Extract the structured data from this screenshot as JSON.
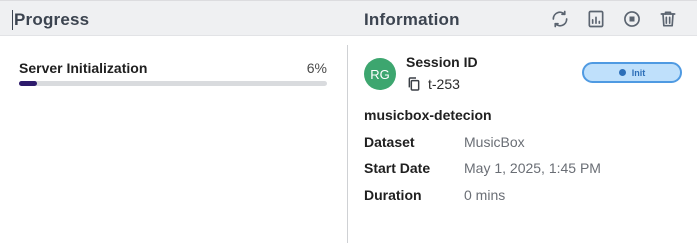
{
  "header": {
    "progress_title": "Progress",
    "info_title": "Information",
    "icons": [
      "refresh-icon",
      "report-icon",
      "stop-icon",
      "delete-icon"
    ]
  },
  "progress": {
    "label": "Server Initialization",
    "value_text": "6%",
    "value": 0.06,
    "bar_color": "#2d1a6b"
  },
  "info": {
    "avatar_initials": "RG",
    "avatar_color": "#3da66f",
    "session_title": "Session ID",
    "session_id": "t-253",
    "status": "Init",
    "experiment_name": "musicbox-detecion",
    "fields": [
      {
        "key": "Dataset",
        "value": "MusicBox"
      },
      {
        "key": "Start Date",
        "value": "May 1, 2025, 1:45 PM"
      },
      {
        "key": "Duration",
        "value": "0 mins"
      }
    ]
  }
}
